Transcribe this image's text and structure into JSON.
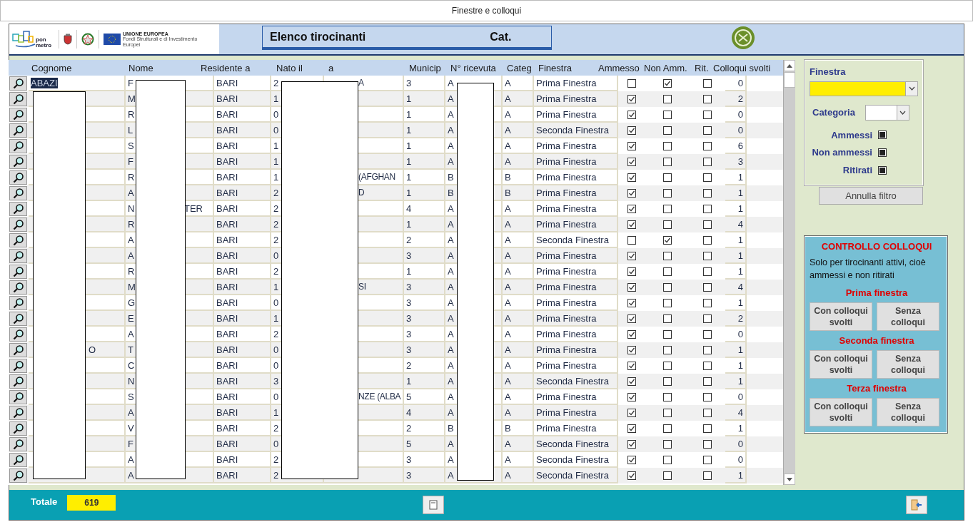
{
  "window": {
    "title": "Finestre e colloqui"
  },
  "header": {
    "pon_metro": "pon metro",
    "eu_title": "UNIONE EUROPEA",
    "eu_subtitle": "Fondi Strutturali e di Investimento Europei",
    "title": "Elenco tirocinanti",
    "category_label": "Cat."
  },
  "table": {
    "columns": [
      "Cognome",
      "Nome",
      "Residente a",
      "Nato il",
      "a",
      "Municip",
      "N° ricevuta",
      "Categ",
      "Finestra",
      "Ammesso",
      "Non Amm.",
      "Rit.",
      "Colloqui svolti"
    ],
    "rows": [
      {
        "selected": true,
        "cognome": "ABAZI",
        "nome": "F",
        "residente": "BARI",
        "nato": "2",
        "luogo": "A",
        "municipio": "3",
        "ricevuta": "A",
        "categoria": "A",
        "finestra": "Prima Finestra",
        "ammesso": false,
        "non_ammesso": true,
        "ritirato": false,
        "colloqui": "0"
      },
      {
        "selected": false,
        "nome": "M",
        "residente": "BARI",
        "nato": "1",
        "municipio": "1",
        "ricevuta": "A",
        "categoria": "A",
        "finestra": "Prima Finestra",
        "ammesso": true,
        "non_ammesso": false,
        "ritirato": false,
        "colloqui": "2"
      },
      {
        "selected": false,
        "nome": "R",
        "residente": "BARI",
        "nato": "0",
        "municipio": "1",
        "ricevuta": "A",
        "categoria": "A",
        "finestra": "Prima Finestra",
        "ammesso": true,
        "non_ammesso": false,
        "ritirato": false,
        "colloqui": "0"
      },
      {
        "selected": false,
        "nome": "L",
        "residente": "BARI",
        "nato": "0",
        "municipio": "1",
        "ricevuta": "A",
        "categoria": "A",
        "finestra": "Seconda Finestra",
        "ammesso": true,
        "non_ammesso": false,
        "ritirato": false,
        "colloqui": "0"
      },
      {
        "selected": false,
        "nome": "S",
        "residente": "BARI",
        "nato": "1",
        "municipio": "1",
        "ricevuta": "A",
        "categoria": "A",
        "finestra": "Prima Finestra",
        "ammesso": true,
        "non_ammesso": false,
        "ritirato": false,
        "colloqui": "6"
      },
      {
        "selected": false,
        "nome": "F",
        "residente": "BARI",
        "nato": "1",
        "municipio": "1",
        "ricevuta": "A",
        "categoria": "A",
        "finestra": "Prima Finestra",
        "ammesso": true,
        "non_ammesso": false,
        "ritirato": false,
        "colloqui": "3"
      },
      {
        "selected": false,
        "nome": "R",
        "residente": "BARI",
        "nato": "1",
        "luogo": "(AFGHAN",
        "municipio": "1",
        "ricevuta": "B",
        "categoria": "B",
        "finestra": "Prima Finestra",
        "ammesso": true,
        "non_ammesso": false,
        "ritirato": false,
        "colloqui": "1"
      },
      {
        "selected": false,
        "nome": "A",
        "residente": "BARI",
        "nato": "2",
        "luogo": "D",
        "municipio": "1",
        "ricevuta": "B",
        "categoria": "B",
        "finestra": "Prima Finestra",
        "ammesso": true,
        "non_ammesso": false,
        "ritirato": false,
        "colloqui": "1"
      },
      {
        "selected": false,
        "nome": "N",
        "nome_tail": "TER",
        "residente": "BARI",
        "nato": "2",
        "municipio": "4",
        "ricevuta": "A",
        "categoria": "A",
        "finestra": "Prima Finestra",
        "ammesso": true,
        "non_ammesso": false,
        "ritirato": false,
        "colloqui": "1"
      },
      {
        "selected": false,
        "nome": "R",
        "residente": "BARI",
        "nato": "2",
        "municipio": "1",
        "ricevuta": "A",
        "categoria": "A",
        "finestra": "Prima Finestra",
        "ammesso": true,
        "non_ammesso": false,
        "ritirato": false,
        "colloqui": "4"
      },
      {
        "selected": false,
        "nome": "A",
        "residente": "BARI",
        "nato": "2",
        "municipio": "2",
        "ricevuta": "A",
        "categoria": "A",
        "finestra": "Seconda Finestra",
        "ammesso": false,
        "non_ammesso": true,
        "ritirato": false,
        "colloqui": "1"
      },
      {
        "selected": false,
        "nome": "A",
        "residente": "BARI",
        "nato": "0",
        "municipio": "3",
        "ricevuta": "A",
        "categoria": "A",
        "finestra": "Prima Finestra",
        "ammesso": true,
        "non_ammesso": false,
        "ritirato": false,
        "colloqui": "1"
      },
      {
        "selected": false,
        "nome": "R",
        "residente": "BARI",
        "nato": "2",
        "municipio": "1",
        "ricevuta": "A",
        "categoria": "A",
        "finestra": "Prima Finestra",
        "ammesso": true,
        "non_ammesso": false,
        "ritirato": false,
        "colloqui": "1"
      },
      {
        "selected": false,
        "nome": "M",
        "residente": "BARI",
        "nato": "1",
        "luogo": "SI",
        "municipio": "3",
        "ricevuta": "A",
        "categoria": "A",
        "finestra": "Prima Finestra",
        "ammesso": true,
        "non_ammesso": false,
        "ritirato": false,
        "colloqui": "4"
      },
      {
        "selected": false,
        "nome": "G",
        "residente": "BARI",
        "nato": "0",
        "municipio": "3",
        "ricevuta": "A",
        "categoria": "A",
        "finestra": "Prima Finestra",
        "ammesso": true,
        "non_ammesso": false,
        "ritirato": false,
        "colloqui": "1"
      },
      {
        "selected": false,
        "nome": "E",
        "residente": "BARI",
        "nato": "1",
        "municipio": "3",
        "ricevuta": "A",
        "categoria": "A",
        "finestra": "Prima Finestra",
        "ammesso": true,
        "non_ammesso": false,
        "ritirato": false,
        "colloqui": "2"
      },
      {
        "selected": false,
        "nome": "A",
        "residente": "BARI",
        "nato": "2",
        "municipio": "3",
        "ricevuta": "A",
        "categoria": "A",
        "finestra": "Prima Finestra",
        "ammesso": true,
        "non_ammesso": false,
        "ritirato": false,
        "colloqui": "0"
      },
      {
        "selected": false,
        "cognome_tail": "O",
        "nome": "T",
        "residente": "BARI",
        "nato": "0",
        "municipio": "3",
        "ricevuta": "A",
        "categoria": "A",
        "finestra": "Prima Finestra",
        "ammesso": true,
        "non_ammesso": false,
        "ritirato": false,
        "colloqui": "1"
      },
      {
        "selected": false,
        "nome": "C",
        "residente": "BARI",
        "nato": "0",
        "municipio": "2",
        "ricevuta": "A",
        "categoria": "A",
        "finestra": "Prima Finestra",
        "ammesso": true,
        "non_ammesso": false,
        "ritirato": false,
        "colloqui": "1"
      },
      {
        "selected": false,
        "nome": "N",
        "residente": "BARI",
        "nato": "3",
        "municipio": "1",
        "ricevuta": "A",
        "categoria": "A",
        "finestra": "Seconda Finestra",
        "ammesso": true,
        "non_ammesso": false,
        "ritirato": false,
        "colloqui": "1"
      },
      {
        "selected": false,
        "nome": "S",
        "residente": "BARI",
        "nato": "0",
        "luogo": "NZE (ALBA",
        "municipio": "5",
        "ricevuta": "A",
        "categoria": "A",
        "finestra": "Prima Finestra",
        "ammesso": true,
        "non_ammesso": false,
        "ritirato": false,
        "colloqui": "0"
      },
      {
        "selected": false,
        "nome": "A",
        "residente": "BARI",
        "nato": "1",
        "municipio": "4",
        "ricevuta": "A",
        "categoria": "A",
        "finestra": "Prima Finestra",
        "ammesso": true,
        "non_ammesso": false,
        "ritirato": false,
        "colloqui": "4"
      },
      {
        "selected": false,
        "nome": "V",
        "residente": "BARI",
        "nato": "2",
        "municipio": "2",
        "ricevuta": "B",
        "categoria": "B",
        "finestra": "Prima Finestra",
        "ammesso": true,
        "non_ammesso": false,
        "ritirato": false,
        "colloqui": "1"
      },
      {
        "selected": false,
        "nome": "F",
        "residente": "BARI",
        "nato": "0",
        "municipio": "5",
        "ricevuta": "A",
        "categoria": "A",
        "finestra": "Seconda Finestra",
        "ammesso": true,
        "non_ammesso": false,
        "ritirato": false,
        "colloqui": "0"
      },
      {
        "selected": false,
        "nome": "A",
        "residente": "BARI",
        "nato": "2",
        "municipio": "3",
        "ricevuta": "A",
        "categoria": "A",
        "finestra": "Seconda Finestra",
        "ammesso": true,
        "non_ammesso": false,
        "ritirato": false,
        "colloqui": "0"
      },
      {
        "selected": false,
        "nome": "A",
        "residente": "BARI",
        "nato": "2",
        "municipio": "3",
        "ricevuta": "A",
        "categoria": "A",
        "finestra": "Seconda Finestra",
        "ammesso": true,
        "non_ammesso": false,
        "ritirato": false,
        "colloqui": "1"
      }
    ]
  },
  "filter": {
    "finestra_label": "Finestra",
    "categoria_label": "Categoria",
    "checks": [
      {
        "label": "Ammessi",
        "checked": true
      },
      {
        "label": "Non ammessi",
        "checked": true
      },
      {
        "label": "Ritirati",
        "checked": true
      }
    ],
    "reset_button": "Annulla filtro"
  },
  "control": {
    "title": "CONTROLLO COLLOQUI",
    "note": "Solo per tirocinanti attivi, cioè ammessi e non ritirati",
    "sections": [
      {
        "title": "Prima finestra",
        "buttons": [
          "Con colloqui svolti",
          "Senza colloqui"
        ]
      },
      {
        "title": "Seconda  finestra",
        "buttons": [
          "Con colloqui svolti",
          "Senza colloqui"
        ]
      },
      {
        "title": "Terza  finestra",
        "buttons": [
          "Con colloqui svolti",
          "Senza colloqui"
        ]
      }
    ]
  },
  "footer": {
    "total_label": "Totale",
    "total_value": "619"
  }
}
